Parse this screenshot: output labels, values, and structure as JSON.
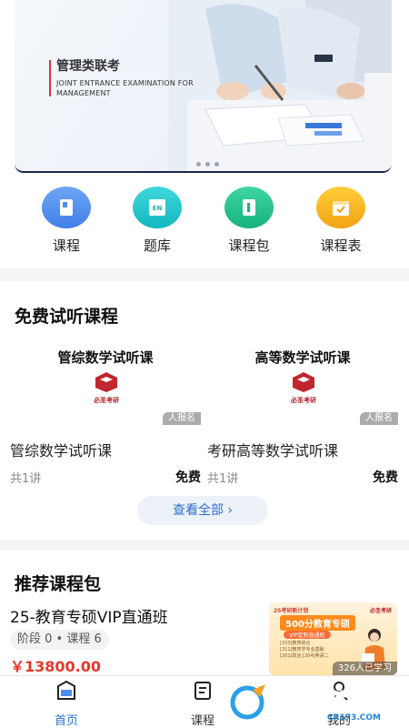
{
  "banner": {
    "title": "管理类联考",
    "subtitle": "JOINT ENTRANCE EXAMINATION FOR MANAGEMENT",
    "dots": 3
  },
  "quick_nav": [
    {
      "label": "课程",
      "icon": "book-icon",
      "color": "#4c8ef0"
    },
    {
      "label": "题库",
      "icon": "en-book-icon",
      "color": "#1fc4c9"
    },
    {
      "label": "课程包",
      "icon": "package-icon",
      "color": "#22c38c"
    },
    {
      "label": "课程表",
      "icon": "calendar-icon",
      "color": "#f7b524"
    }
  ],
  "free_courses": {
    "section_title": "免费试听课程",
    "items": [
      {
        "thumb_title": "管综数学试听课",
        "logo_text": "必圣考研",
        "enroll_text": "人报名",
        "name": "管综数学试听课",
        "lessons": "共1讲",
        "price": "免费"
      },
      {
        "thumb_title": "高等数学试听课",
        "logo_text": "必圣考研",
        "enroll_text": "人报名",
        "name": "考研高等数学试听课",
        "lessons": "共1讲",
        "price": "免费"
      }
    ],
    "view_all": "查看全部 ›"
  },
  "packages": {
    "section_title": "推荐课程包",
    "items": [
      {
        "name": "25-教育专硕VIP直通班",
        "meta": "阶段 0 • 课程 6",
        "price": "￥13800.00",
        "thumb": {
          "header": "25考研新计划",
          "brand": "必圣考研",
          "headline": "500分教育专硕",
          "pill": "VIP定制直通班",
          "lines": [
            "[333]教育综合",
            "[311]教育学专业基础",
            "[201]政治 [204]英语二"
          ],
          "learners": "326人已学习"
        }
      }
    ]
  },
  "tabbar": [
    {
      "label": "首页",
      "icon": "home-icon",
      "active": true
    },
    {
      "label": "课程",
      "icon": "course-icon",
      "active": false
    },
    {
      "label": "我的",
      "icon": "profile-icon",
      "active": false
    }
  ],
  "watermark": {
    "brand": "西西软件园",
    "url": "CR173.COM"
  },
  "colors": {
    "accent": "#2c6fd1",
    "price_red": "#e6372d"
  }
}
